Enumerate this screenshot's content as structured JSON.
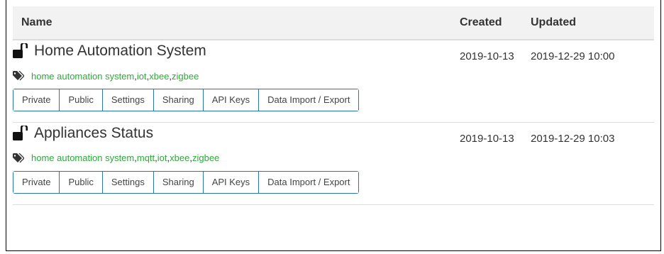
{
  "table": {
    "headers": {
      "name": "Name",
      "created": "Created",
      "updated": "Updated"
    }
  },
  "projects": [
    {
      "title": "Home Automation System",
      "tags": [
        "home automation system",
        "iot",
        "xbee",
        "zigbee"
      ],
      "created": "2019-10-13",
      "updated": "2019-12-29 10:00"
    },
    {
      "title": "Appliances Status",
      "tags": [
        "home automation system",
        "mqtt",
        "iot",
        "xbee",
        "zigbee"
      ],
      "created": "2019-10-13",
      "updated": "2019-12-29 10:03"
    }
  ],
  "actions": [
    "Private",
    "Public",
    "Settings",
    "Sharing",
    "API Keys",
    "Data Import / Export"
  ],
  "icons": {
    "lock": "unlocked-padlock-icon",
    "tag": "tag-icon"
  },
  "colors": {
    "tag": "#2eaa3a",
    "button_border": "#2a74b8",
    "header_bg": "#f2f2f2"
  }
}
